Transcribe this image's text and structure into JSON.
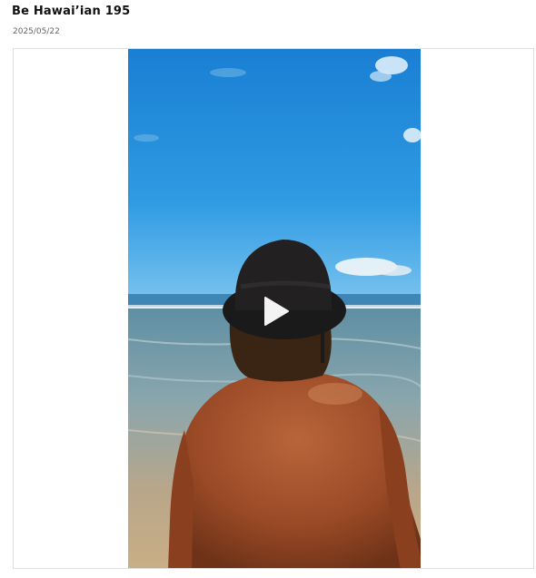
{
  "post": {
    "title": "Be Hawai’ian 195",
    "date": "2025/05/22"
  },
  "video": {
    "play_icon": "play-icon",
    "colors": {
      "sky_top": "#1f86d6",
      "sky_bottom": "#5ab4ec",
      "sea": "#6f98a9",
      "sand": "#c9a77d",
      "hat": "#1b1a1a",
      "skin": "#a4532c",
      "hair": "#3a2414"
    }
  }
}
